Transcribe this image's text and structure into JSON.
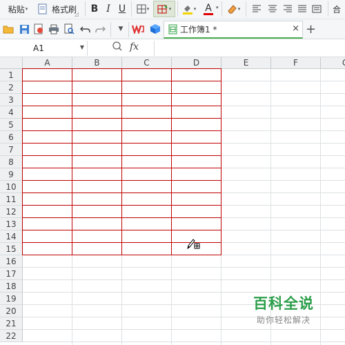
{
  "ribbon": {
    "paste_label": "粘贴",
    "format_painter_label": "格式刷",
    "bold": "B",
    "italic": "I",
    "underline": "U",
    "font_color_glyph": "A",
    "merge_label": "合",
    "bold_glyph": "B"
  },
  "tab": {
    "title": "工作簿1 *",
    "close": "×",
    "new": "+"
  },
  "formula_bar": {
    "name_box_value": "A1",
    "formula_value": "",
    "fx": "fx",
    "zoom_icon": "🔍",
    "fx_icon": "fx"
  },
  "sheet": {
    "columns": [
      "A",
      "B",
      "C",
      "D",
      "E",
      "F",
      "G"
    ],
    "rows": [
      "1",
      "2",
      "3",
      "4",
      "5",
      "6",
      "7",
      "8",
      "9",
      "10",
      "11",
      "12",
      "13",
      "14",
      "15",
      "16",
      "17",
      "18",
      "19",
      "20",
      "21",
      "22"
    ],
    "border_color": "#c00000",
    "bordered_range": "A1:D15"
  },
  "watermark": {
    "title": "百科全说",
    "subtitle": "助你轻松解决"
  },
  "colors": {
    "accent": "#4caf50",
    "border_red": "#c00000",
    "watermark_green": "#2b9e4a"
  },
  "icons": [
    "open-folder-icon",
    "save-icon",
    "pdf-icon",
    "print-icon",
    "print-preview-icon",
    "undo-icon",
    "redo-icon",
    "dropdown-icon",
    "wps-logo-icon",
    "cube-icon",
    "sheet-doc-icon",
    "pen-cursor-icon"
  ]
}
